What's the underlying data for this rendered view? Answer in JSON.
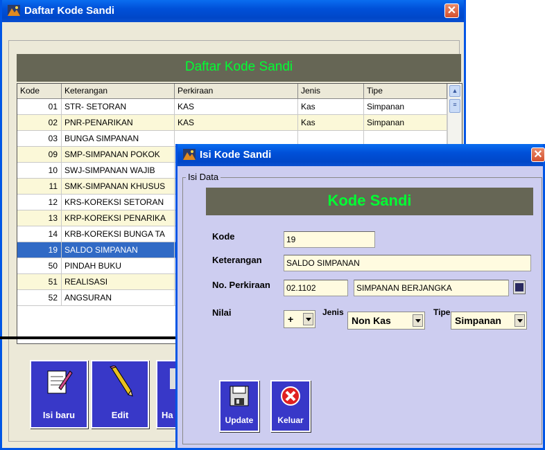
{
  "main_window": {
    "title": "Daftar Kode Sandi",
    "banner": "Daftar Kode Sandi",
    "columns": [
      "Kode",
      "Keterangan",
      "Perkiraan",
      "Jenis",
      "Tipe"
    ],
    "rows": [
      {
        "kode": "01",
        "keterangan": "STR- SETORAN",
        "perkiraan": "KAS",
        "jenis": "Kas",
        "tipe": "Simpanan"
      },
      {
        "kode": "02",
        "keterangan": "PNR-PENARIKAN",
        "perkiraan": "KAS",
        "jenis": "Kas",
        "tipe": "Simpanan"
      },
      {
        "kode": "03",
        "keterangan": "BUNGA SIMPANAN",
        "perkiraan": "",
        "jenis": "",
        "tipe": ""
      },
      {
        "kode": "09",
        "keterangan": "SMP-SIMPANAN POKOK",
        "perkiraan": "",
        "jenis": "",
        "tipe": ""
      },
      {
        "kode": "10",
        "keterangan": "SWJ-SIMPANAN WAJIB",
        "perkiraan": "",
        "jenis": "",
        "tipe": ""
      },
      {
        "kode": "11",
        "keterangan": "SMK-SIMPANAN KHUSUS",
        "perkiraan": "",
        "jenis": "",
        "tipe": ""
      },
      {
        "kode": "12",
        "keterangan": "KRS-KOREKSI SETORAN",
        "perkiraan": "",
        "jenis": "",
        "tipe": ""
      },
      {
        "kode": "13",
        "keterangan": "KRP-KOREKSI PENARIKA",
        "perkiraan": "",
        "jenis": "",
        "tipe": ""
      },
      {
        "kode": "14",
        "keterangan": "KRB-KOREKSI BUNGA TA",
        "perkiraan": "",
        "jenis": "",
        "tipe": ""
      },
      {
        "kode": "19",
        "keterangan": "SALDO SIMPANAN",
        "perkiraan": "",
        "jenis": "",
        "tipe": ""
      },
      {
        "kode": "50",
        "keterangan": "PINDAH BUKU",
        "perkiraan": "",
        "jenis": "",
        "tipe": ""
      },
      {
        "kode": "51",
        "keterangan": "REALISASI",
        "perkiraan": "",
        "jenis": "",
        "tipe": ""
      },
      {
        "kode": "52",
        "keterangan": "ANGSURAN",
        "perkiraan": "",
        "jenis": "",
        "tipe": ""
      }
    ],
    "selected_row_index": 9,
    "buttons": {
      "isi_baru": "Isi baru",
      "edit": "Edit",
      "hapus": "Ha"
    }
  },
  "dialog": {
    "title": "Isi Kode Sandi",
    "group_label": "Isi Data",
    "banner": "Kode Sandi",
    "fields": {
      "kode_label": "Kode",
      "kode_value": "19",
      "keterangan_label": "Keterangan",
      "keterangan_value": "SALDO SIMPANAN",
      "perkiraan_label": "No. Perkiraan",
      "perkiraan_code": "02.1102",
      "perkiraan_name": "SIMPANAN BERJANGKA",
      "nilai_label": "Nilai",
      "nilai_value": "+",
      "jenis_label": "Jenis",
      "jenis_value": "Non Kas",
      "tipe_label": "Tipe",
      "tipe_value": "Simpanan"
    },
    "buttons": {
      "update": "Update",
      "keluar": "Keluar"
    }
  },
  "colors": {
    "banner_bg": "#666655",
    "banner_text": "#00ff33",
    "selection": "#316ac5",
    "button_bg": "#3838c8"
  }
}
